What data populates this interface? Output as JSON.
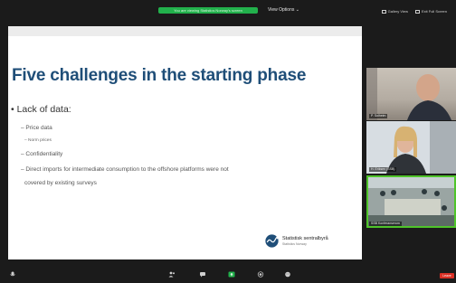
{
  "topbar": {
    "share_label": "You are viewing Statistics Norway's screen",
    "view_options": "View Options ⌄",
    "gallery_view": "Gallery View",
    "exit_fullscreen": "Exit Full Screen"
  },
  "slide": {
    "title": "Five challenges in the starting phase",
    "bullet": "Lack of data:",
    "items": [
      "Price data",
      "Confidentiality",
      "Direct imports for intermediate consumption to the offshore platforms were not",
      "covered by existing surveys"
    ],
    "sub_item": "Norm prices",
    "logo_line1": "Statistisk sentralbyrå",
    "logo_line2": "Statistics Norway",
    "logo_color": "#1f4e78"
  },
  "participants": [
    {
      "name": "P. Solheim"
    },
    {
      "name": "H. Eriksen (SSB)"
    },
    {
      "name": "SSB Konferanserom"
    }
  ],
  "toolbar": {
    "leave_label": "Leave",
    "icons": [
      "mute-icon",
      "participants-icon",
      "chat-icon",
      "share-screen-icon",
      "record-icon",
      "reactions-icon"
    ]
  }
}
